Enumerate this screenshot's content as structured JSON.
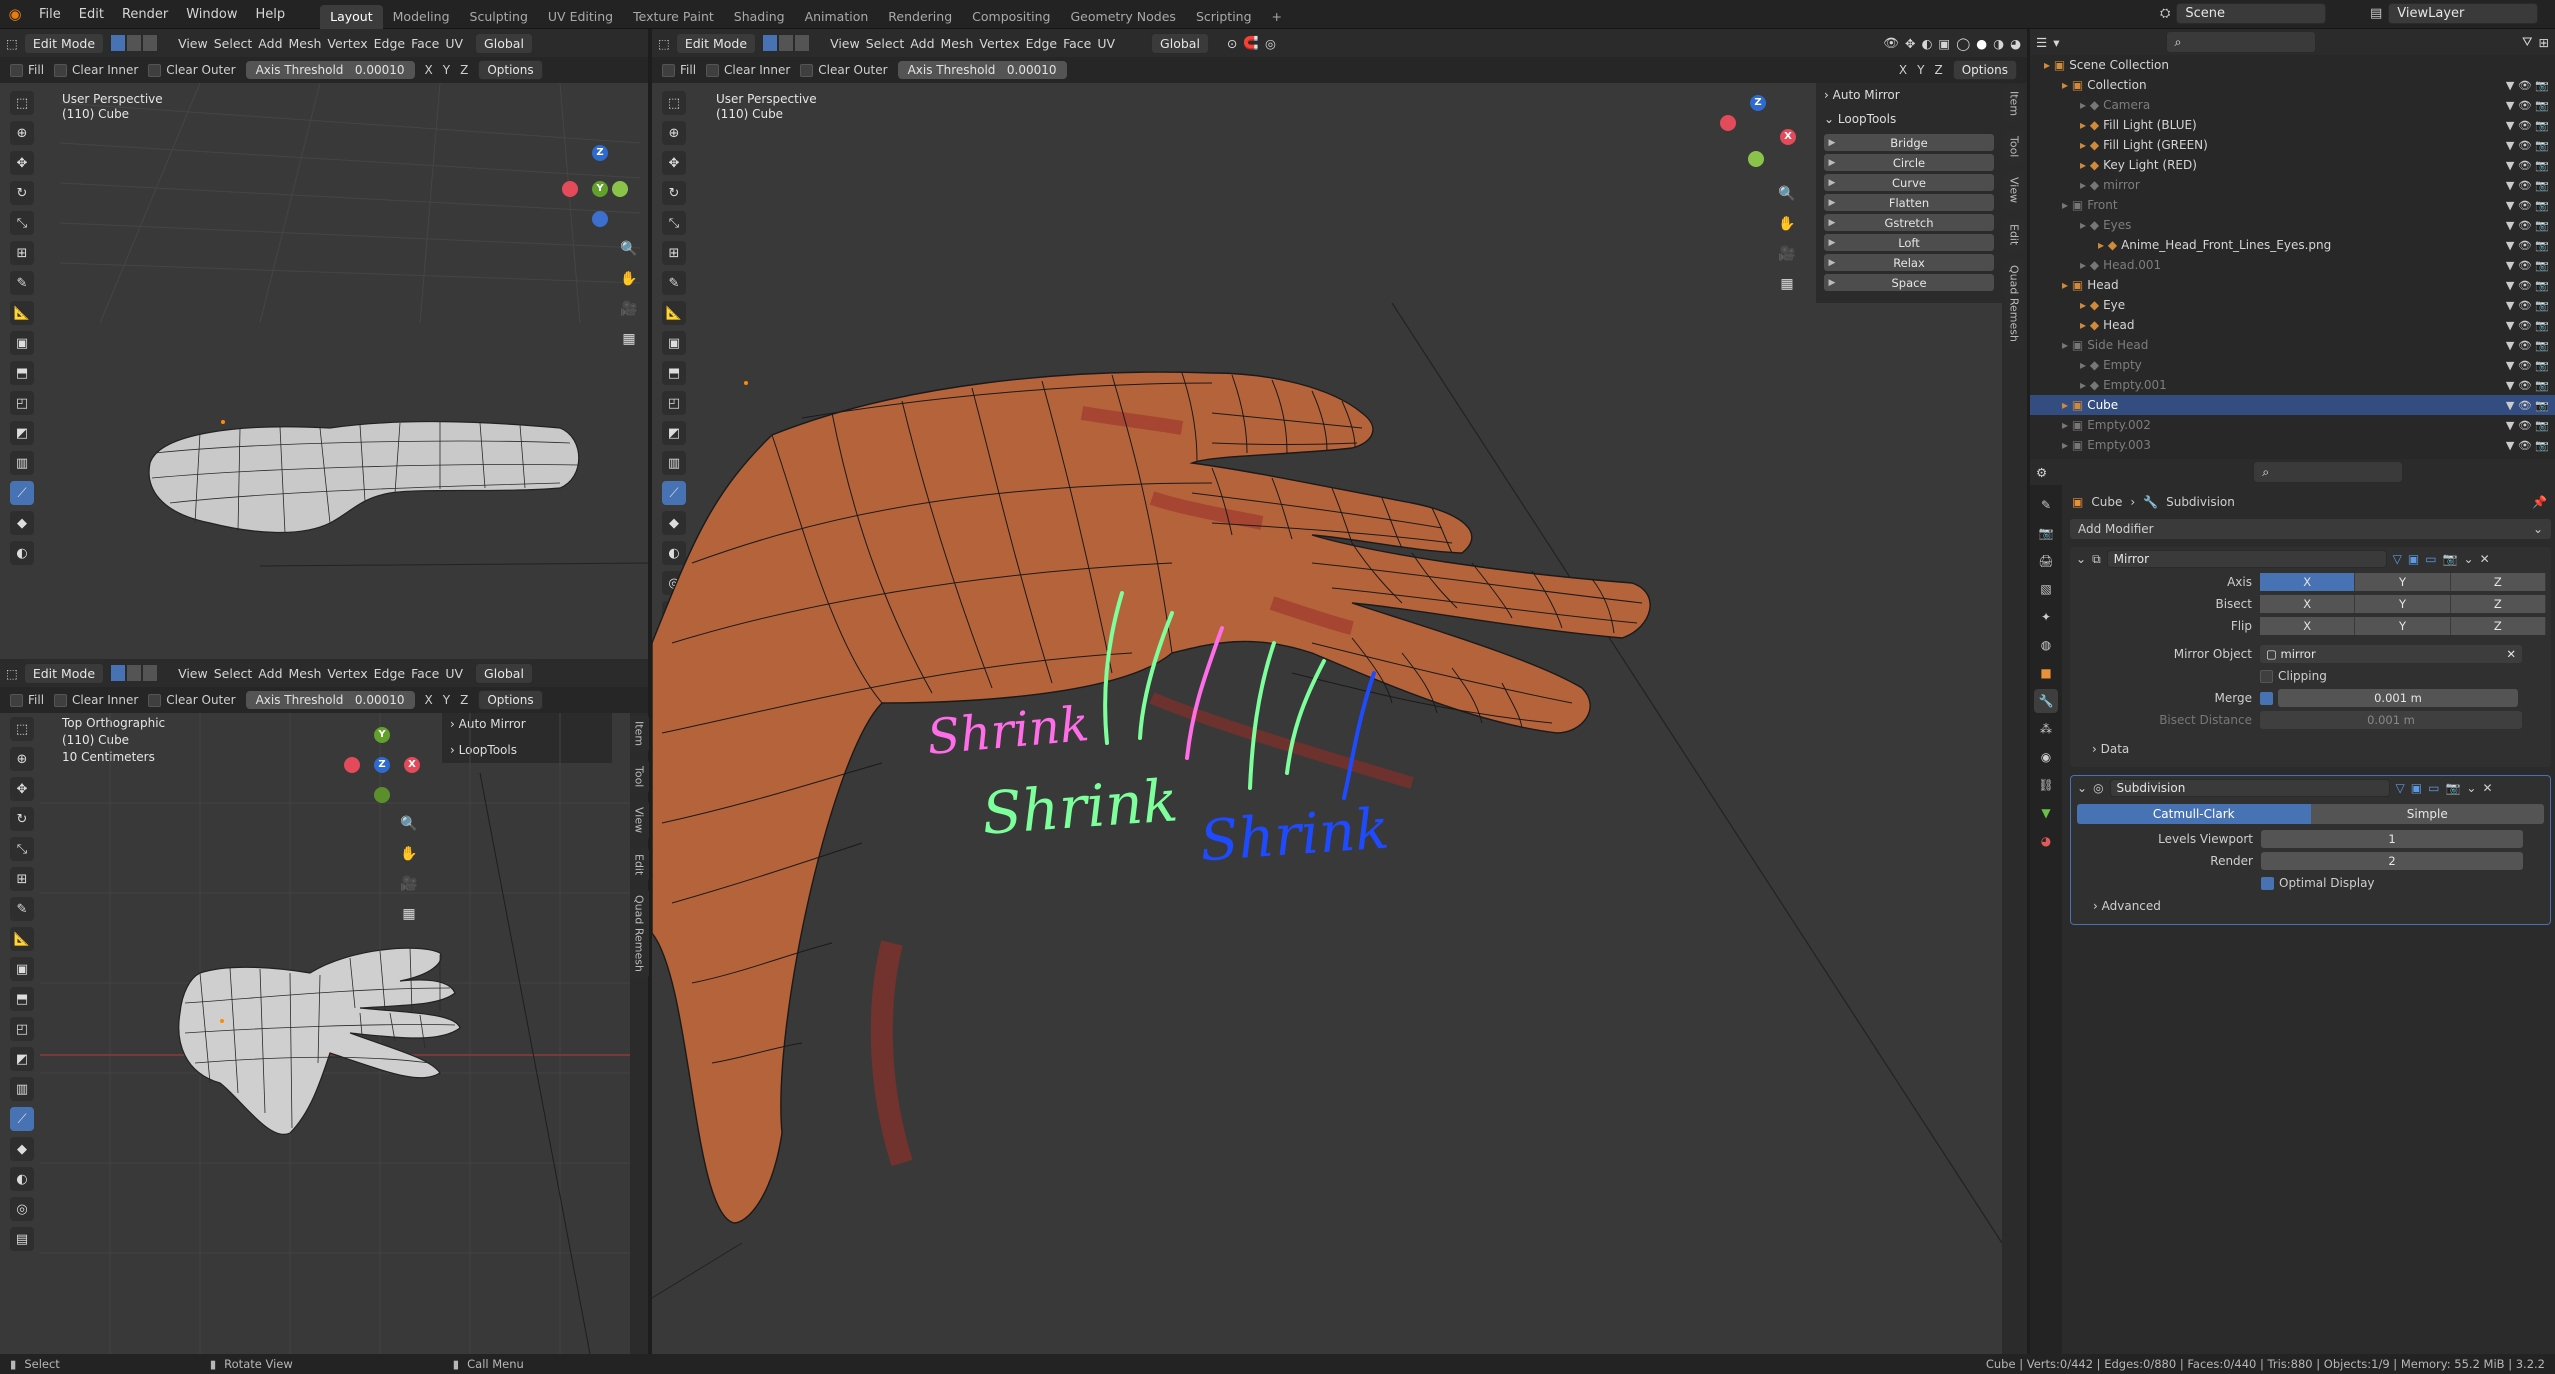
{
  "menu": [
    "File",
    "Edit",
    "Render",
    "Window",
    "Help"
  ],
  "workspaces": [
    "Layout",
    "Modeling",
    "Sculpting",
    "UV Editing",
    "Texture Paint",
    "Shading",
    "Animation",
    "Rendering",
    "Compositing",
    "Geometry Nodes",
    "Scripting"
  ],
  "active_workspace": "Layout",
  "scene": "Scene",
  "viewlayer": "ViewLayer",
  "view_header": {
    "mode": "Edit Mode",
    "menus": [
      "View",
      "Select",
      "Add",
      "Mesh",
      "Vertex",
      "Edge",
      "Face",
      "UV"
    ],
    "transform": "Global",
    "options": "Options",
    "fill": "Fill",
    "clear_inner": "Clear Inner",
    "clear_outer": "Clear Outer",
    "axis_threshold_label": "Axis Threshold",
    "axis_threshold_value": "0.00010",
    "axes": [
      "X",
      "Y",
      "Z"
    ]
  },
  "viewport_tl": {
    "line1": "User Perspective",
    "line2": "(110) Cube"
  },
  "viewport_bl": {
    "line1": "Top Orthographic",
    "line2": "(110) Cube",
    "line3": "10 Centimeters",
    "panel_auto_mirror": "Auto Mirror",
    "panel_looptools": "LoopTools"
  },
  "viewport_main": {
    "line1": "User Perspective",
    "line2": "(110) Cube",
    "panel_auto_mirror": "Auto Mirror",
    "panel_looptools": "LoopTools",
    "looptools_buttons": [
      "Bridge",
      "Circle",
      "Curve",
      "Flatten",
      "Gstretch",
      "Loft",
      "Relax",
      "Space"
    ],
    "annotations": [
      {
        "text": "Shrink",
        "color": "#ff6ee8"
      },
      {
        "text": "Shrink",
        "color": "#7dff9b"
      },
      {
        "text": "Shrink",
        "color": "#1f4bff"
      }
    ]
  },
  "side_tabs": [
    "Item",
    "Tool",
    "View",
    "Edit",
    "Quad Remesh"
  ],
  "outliner": {
    "rows": [
      {
        "name": "Scene Collection",
        "depth": 0,
        "dim": false,
        "sel": false
      },
      {
        "name": "Collection",
        "depth": 1,
        "dim": false,
        "sel": false
      },
      {
        "name": "Camera",
        "depth": 2,
        "dim": true,
        "sel": false
      },
      {
        "name": "Fill Light (BLUE)",
        "depth": 2,
        "dim": false,
        "sel": false
      },
      {
        "name": "Fill Light (GREEN)",
        "depth": 2,
        "dim": false,
        "sel": false
      },
      {
        "name": "Key Light (RED)",
        "depth": 2,
        "dim": false,
        "sel": false
      },
      {
        "name": "mirror",
        "depth": 2,
        "dim": true,
        "sel": false
      },
      {
        "name": "Front",
        "depth": 1,
        "dim": true,
        "sel": false
      },
      {
        "name": "Eyes",
        "depth": 2,
        "dim": true,
        "sel": false
      },
      {
        "name": "Anime_Head_Front_Lines_Eyes.png",
        "depth": 3,
        "dim": false,
        "sel": false
      },
      {
        "name": "Head.001",
        "depth": 2,
        "dim": true,
        "sel": false
      },
      {
        "name": "Head",
        "depth": 1,
        "dim": false,
        "sel": false
      },
      {
        "name": "Eye",
        "depth": 2,
        "dim": false,
        "sel": false
      },
      {
        "name": "Head",
        "depth": 2,
        "dim": false,
        "sel": false
      },
      {
        "name": "Side Head",
        "depth": 1,
        "dim": true,
        "sel": false
      },
      {
        "name": "Empty",
        "depth": 2,
        "dim": true,
        "sel": false
      },
      {
        "name": "Empty.001",
        "depth": 2,
        "dim": true,
        "sel": false
      },
      {
        "name": "Cube",
        "depth": 1,
        "dim": false,
        "sel": true
      },
      {
        "name": "Empty.002",
        "depth": 1,
        "dim": true,
        "sel": false
      },
      {
        "name": "Empty.003",
        "depth": 1,
        "dim": true,
        "sel": false
      }
    ]
  },
  "properties": {
    "breadcrumb_obj": "Cube",
    "breadcrumb_mod": "Subdivision",
    "add_modifier": "Add Modifier",
    "mirror": {
      "name": "Mirror",
      "axis_label": "Axis",
      "bisect_label": "Bisect",
      "flip_label": "Flip",
      "mirror_object_label": "Mirror Object",
      "mirror_object": "mirror",
      "clipping": "Clipping",
      "merge_label": "Merge",
      "merge_value": "0.001 m",
      "bisect_distance_label": "Bisect Distance",
      "bisect_distance_value": "0.001 m",
      "data": "Data"
    },
    "subdivision": {
      "name": "Subdivision",
      "catmull": "Catmull-Clark",
      "simple": "Simple",
      "levels_label": "Levels Viewport",
      "levels_value": "1",
      "render_label": "Render",
      "render_value": "2",
      "optimal": "Optimal Display",
      "advanced": "Advanced"
    }
  },
  "status": {
    "select": "Select",
    "rotate": "Rotate View",
    "call_menu": "Call Menu",
    "stats": "Cube | Verts:0/442 | Edges:0/880 | Faces:0/440 | Tris:880 | Objects:1/9 | Memory: 55.2 MiB | 3.2.2"
  },
  "colors": {
    "accent": "#4772b3",
    "skin": "#b5633a",
    "bg_viewport": "#393939"
  }
}
